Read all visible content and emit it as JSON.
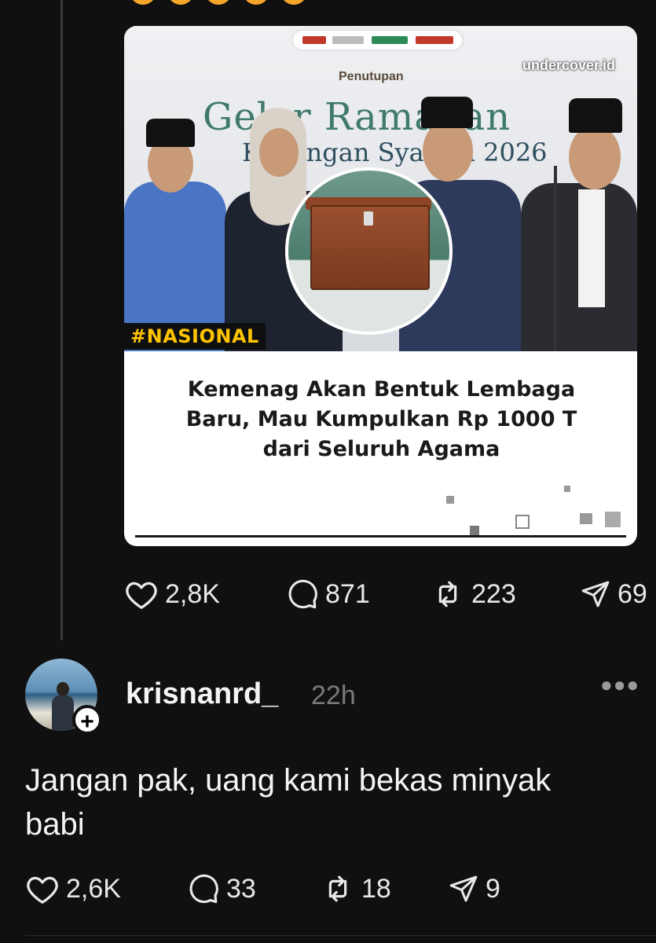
{
  "post": {
    "image": {
      "event_subtitle": "Penutupan",
      "event_title_line1": "Gelar Ramadan",
      "event_title_line2": "Keuangan Syariah 2026",
      "watermark": "undercover.id",
      "hashtag": "#NASIONAL",
      "headline_line1": "Kemenag Akan Bentuk Lembaga",
      "headline_line2": "Baru, Mau Kumpulkan Rp 1000 T",
      "headline_line3": "dari Seluruh Agama"
    },
    "stats": {
      "likes": "2,8K",
      "replies": "871",
      "reposts": "223",
      "shares": "69"
    }
  },
  "reply": {
    "username": "krisnanrd_",
    "time": "22h",
    "text_line1": "Jangan pak, uang kami bekas minyak",
    "text_line2": "babi",
    "stats": {
      "likes": "2,6K",
      "replies": "33",
      "reposts": "18",
      "shares": "9"
    }
  },
  "icons": [
    "heart-icon",
    "comment-icon",
    "repost-icon",
    "share-icon",
    "more-icon",
    "plus-icon"
  ],
  "colors": {
    "background": "#101010",
    "text": "#f3f5f7",
    "muted": "#7a7a7a",
    "hashtag": "#ffc400"
  }
}
